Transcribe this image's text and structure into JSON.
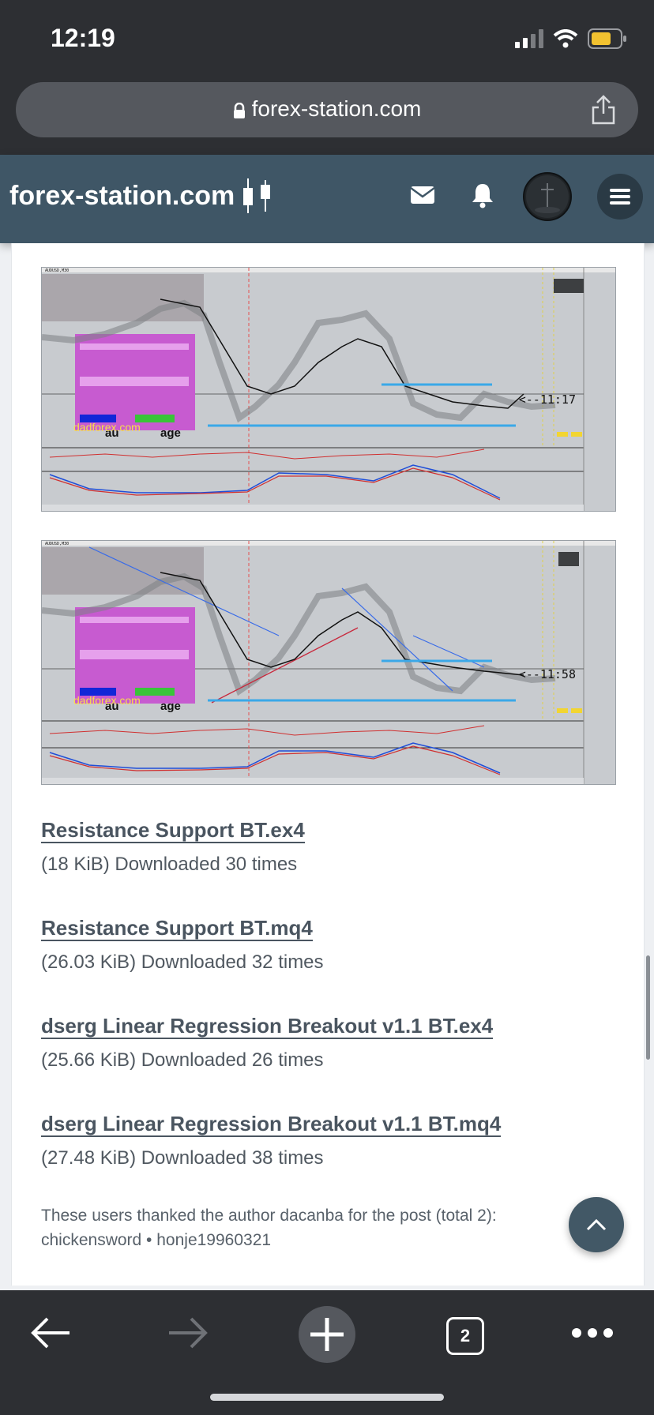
{
  "status": {
    "time": "12:19"
  },
  "browser": {
    "url": "forex-station.com",
    "tab_count": "2"
  },
  "site": {
    "logo_text": "forex-station.com"
  },
  "charts": [
    {
      "symbol": "AUDUSD,M30",
      "price_label": "<--11:17"
    },
    {
      "symbol": "AUDUSD,M30",
      "price_label": "<--11:58"
    }
  ],
  "attachments": [
    {
      "name": "Resistance Support BT.ex4",
      "meta": "(18 KiB) Downloaded 30 times"
    },
    {
      "name": "Resistance Support BT.mq4",
      "meta": "(26.03 KiB) Downloaded 32 times"
    },
    {
      "name": "dserg Linear Regression Breakout v1.1 BT.ex4",
      "meta": "(25.66 KiB) Downloaded 26 times"
    },
    {
      "name": "dserg Linear Regression Breakout v1.1 BT.mq4",
      "meta": "(27.48 KiB) Downloaded 38 times"
    }
  ],
  "thanks": {
    "line1": "These users thanked the author dacanba for the post (total 2):",
    "line2": "chickensword • honje19960321"
  },
  "colors": {
    "header": "#3f5666",
    "browser_chrome": "#2d2f33",
    "battery": "#f2c230"
  }
}
